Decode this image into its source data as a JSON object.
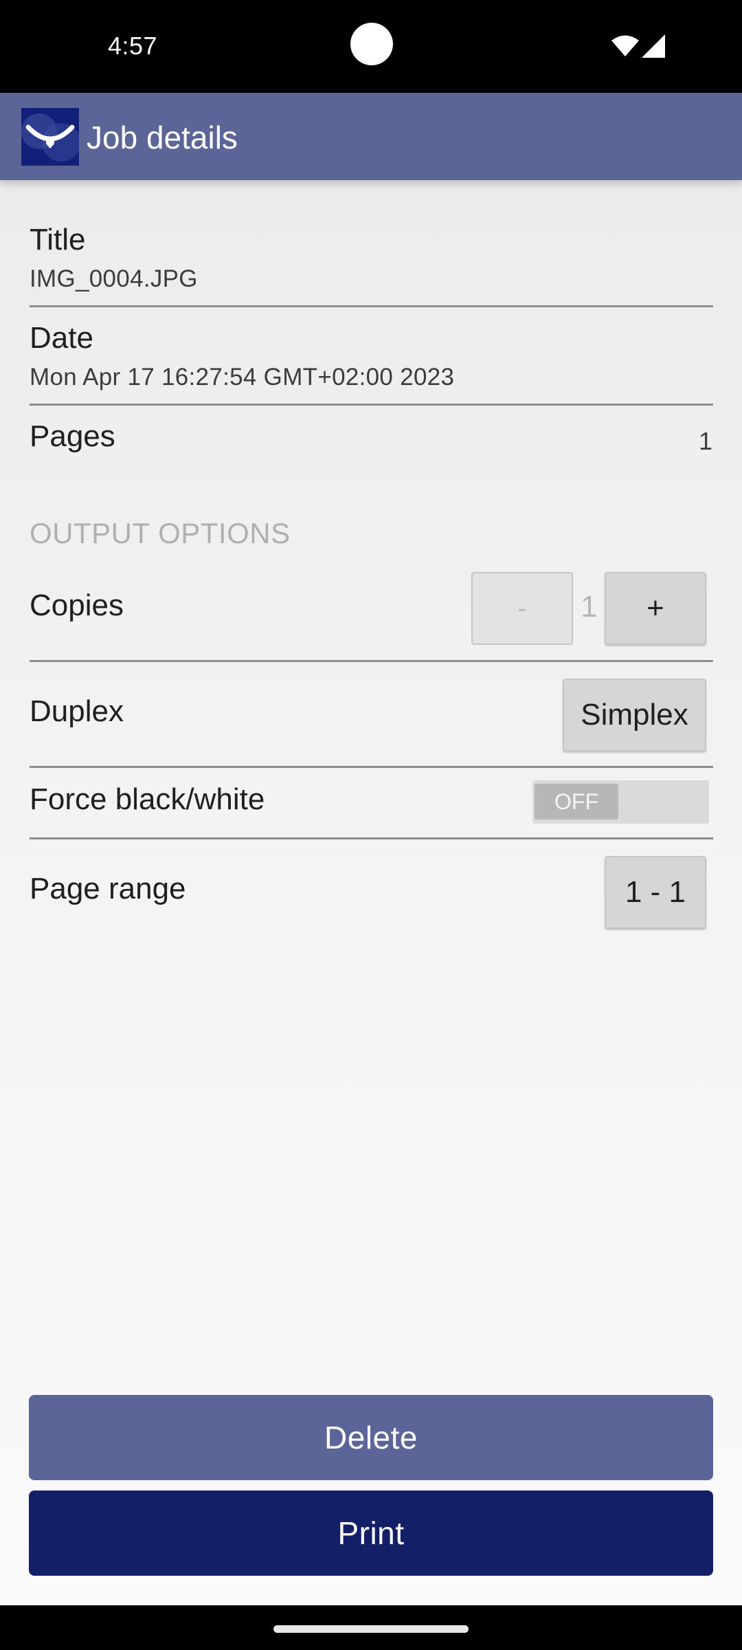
{
  "status_bar": {
    "time": "4:57"
  },
  "app_bar": {
    "title": "Job details",
    "logo_icon": "app-logo-icon"
  },
  "details": {
    "title_label": "Title",
    "title_value": "IMG_0004.JPG",
    "date_label": "Date",
    "date_value": "Mon Apr 17 16:27:54 GMT+02:00 2023",
    "pages_label": "Pages",
    "pages_value": "1"
  },
  "output_options": {
    "header": "OUTPUT OPTIONS",
    "copies_label": "Copies",
    "copies_minus": "-",
    "copies_value": "1",
    "copies_plus": "+",
    "duplex_label": "Duplex",
    "duplex_value": "Simplex",
    "force_bw_label": "Force black/white",
    "force_bw_state": "OFF",
    "page_range_label": "Page range",
    "page_range_value": "1 - 1"
  },
  "actions": {
    "delete_label": "Delete",
    "print_label": "Print"
  },
  "colors": {
    "app_bar": "#5b6598",
    "delete_button": "#5b6598",
    "print_button": "#131f66"
  }
}
